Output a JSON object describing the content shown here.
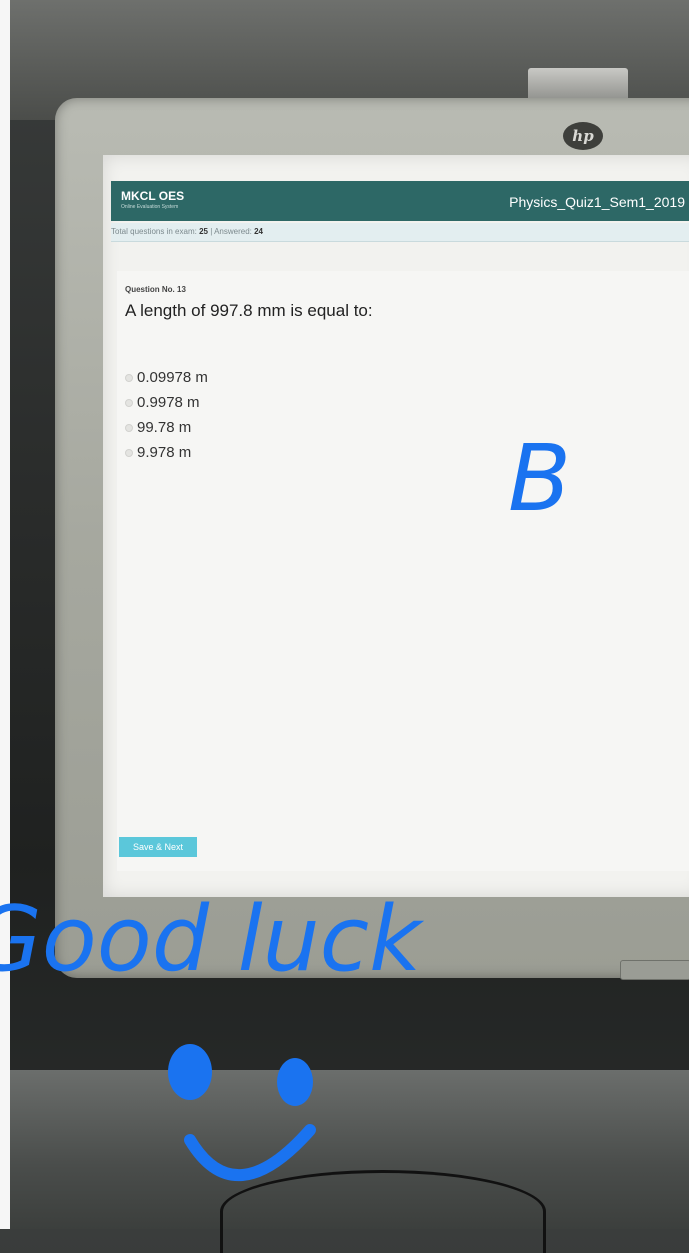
{
  "monitor": {
    "brand_logo": "hp"
  },
  "app": {
    "brand_name": "MKCL OES",
    "brand_subtitle": "Online Evaluation System",
    "exam_title": "Physics_Quiz1_Sem1_2019"
  },
  "stats": {
    "total_label": "Total questions in exam:",
    "total_value": "25",
    "separator": "| Answered:",
    "answered_value": "24"
  },
  "question": {
    "number_label": "Question No. 13",
    "text": "A length of 997.8 mm is equal to:",
    "options": [
      "0.09978 m",
      "0.9978 m",
      "99.78 m",
      "9.978 m"
    ]
  },
  "actions": {
    "save_next_label": "Save & Next"
  },
  "annotations": {
    "answer_mark": "B",
    "message": "Good luck"
  },
  "colors": {
    "header": "#2d6866",
    "save_button": "#5bc7da",
    "ink": "#1a73f0"
  }
}
